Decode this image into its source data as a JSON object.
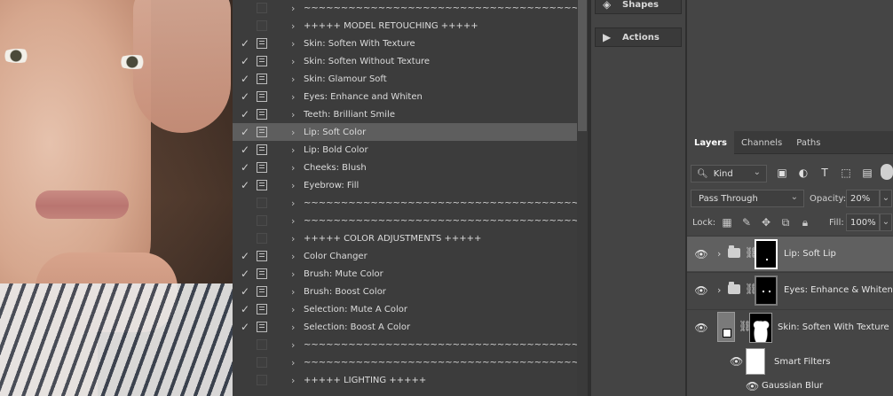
{
  "actions_panel": {
    "rows": [
      {
        "label": "~~~~~~~~~~~~~~~~~~~~~~~~~~~~~~~~~~~~~~~~",
        "checked": false,
        "has_dialog": false,
        "selected": false
      },
      {
        "label": "+++++ MODEL RETOUCHING +++++",
        "checked": false,
        "has_dialog": false,
        "selected": false
      },
      {
        "label": "Skin: Soften With Texture",
        "checked": true,
        "has_dialog": true,
        "selected": false
      },
      {
        "label": "Skin: Soften Without Texture",
        "checked": true,
        "has_dialog": true,
        "selected": false
      },
      {
        "label": "Skin: Glamour Soft",
        "checked": true,
        "has_dialog": true,
        "selected": false
      },
      {
        "label": "Eyes: Enhance and Whiten",
        "checked": true,
        "has_dialog": true,
        "selected": false
      },
      {
        "label": "Teeth: Brilliant Smile",
        "checked": true,
        "has_dialog": true,
        "selected": false
      },
      {
        "label": "Lip: Soft Color",
        "checked": true,
        "has_dialog": true,
        "selected": true
      },
      {
        "label": "Lip: Bold Color",
        "checked": true,
        "has_dialog": true,
        "selected": false
      },
      {
        "label": "Cheeks: Blush",
        "checked": true,
        "has_dialog": true,
        "selected": false
      },
      {
        "label": "Eyebrow: Fill",
        "checked": true,
        "has_dialog": true,
        "selected": false
      },
      {
        "label": "~~~~~~~~~~~~~~~~~~~~~~~~~~~~~~~~~~~~~~~~",
        "checked": false,
        "has_dialog": false,
        "selected": false
      },
      {
        "label": "~~~~~~~~~~~~~~~~~~~~~~~~~~~~~~~~~~~~~~~~",
        "checked": false,
        "has_dialog": false,
        "selected": false
      },
      {
        "label": "+++++ COLOR ADJUSTMENTS +++++",
        "checked": false,
        "has_dialog": false,
        "selected": false
      },
      {
        "label": "Color Changer",
        "checked": true,
        "has_dialog": true,
        "selected": false
      },
      {
        "label": "Brush: Mute Color",
        "checked": true,
        "has_dialog": true,
        "selected": false
      },
      {
        "label": "Brush: Boost Color",
        "checked": true,
        "has_dialog": true,
        "selected": false
      },
      {
        "label": "Selection: Mute A Color",
        "checked": true,
        "has_dialog": true,
        "selected": false
      },
      {
        "label": "Selection: Boost A Color",
        "checked": true,
        "has_dialog": true,
        "selected": false
      },
      {
        "label": "~~~~~~~~~~~~~~~~~~~~~~~~~~~~~~~~~~~~~~~~",
        "checked": false,
        "has_dialog": false,
        "selected": false
      },
      {
        "label": "~~~~~~~~~~~~~~~~~~~~~~~~~~~~~~~~~~~~~~~~",
        "checked": false,
        "has_dialog": false,
        "selected": false
      },
      {
        "label": "+++++ LIGHTING +++++",
        "checked": false,
        "has_dialog": false,
        "selected": false
      }
    ]
  },
  "mid_panel": {
    "shapes_label": "Shapes",
    "actions_label": "Actions"
  },
  "layers_panel": {
    "tabs": [
      "Layers",
      "Channels",
      "Paths"
    ],
    "kind_label": "Kind",
    "blend_mode": "Pass Through",
    "opacity_label": "Opacity:",
    "opacity_value": "20%",
    "lock_label": "Lock:",
    "fill_label": "Fill:",
    "fill_value": "100%",
    "layers": [
      {
        "name": "Lip: Soft Lip",
        "type": "group",
        "selected": true
      },
      {
        "name": "Eyes: Enhance & Whiten",
        "type": "group",
        "selected": false
      },
      {
        "name": "Skin: Soften With Texture",
        "type": "smart",
        "selected": false
      }
    ],
    "smart_filters_label": "Smart Filters",
    "filter_name": "Gaussian Blur"
  }
}
